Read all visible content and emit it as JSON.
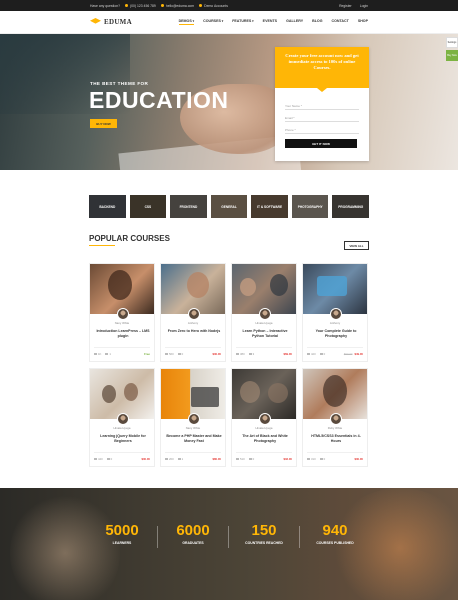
{
  "topbar": {
    "question": "Have any question?",
    "phone": "(00) 123 456 789",
    "email": "hello@eduma.com",
    "demo": "Demo Accounts",
    "register": "Register",
    "login": "Login"
  },
  "header": {
    "logo": "EDUMA",
    "nav": [
      "Demos",
      "Courses",
      "Features",
      "Events",
      "Gallery",
      "Blog",
      "Contact",
      "Shop"
    ]
  },
  "widgets": {
    "settings": "Settings",
    "buy_now": "Buy Now"
  },
  "hero": {
    "subtitle": "THE BEST THEME FOR",
    "title": "EDUCATION",
    "button": "BUY NOW"
  },
  "signup": {
    "heading": "Create your free account now and get immediate access to 100s of online Courses.",
    "name_placeholder": "Your Name *",
    "email_placeholder": "Email *",
    "phone_placeholder": "Phone *",
    "button": "GET IT NOW"
  },
  "categories": [
    "BACKEND",
    "CSS",
    "FRONTEND",
    "GENERAL",
    "IT & SOFTWARE",
    "PHOTOGRAPHY",
    "PROGRAMMING"
  ],
  "popular": {
    "title": "POPULAR COURSES",
    "view_all": "VIEW ALL"
  },
  "courses": [
    {
      "teacher": "Nany White",
      "title": "Introduction LearnPress – LMS plugin",
      "views": "1K",
      "comments": "1",
      "price": "Free",
      "old_price": ""
    },
    {
      "teacher": "Anthony",
      "title": "From Zero to Hero with Nodejs",
      "views": "560",
      "comments": "0",
      "price": "$30.00",
      "old_price": ""
    },
    {
      "teacher": "Hinata Hyuga",
      "title": "Learn Python – Interactive Python Tutorial",
      "views": "380",
      "comments": "3",
      "price": "$69.00",
      "old_price": ""
    },
    {
      "teacher": "Anthony",
      "title": "Your Complete Guide to Photography",
      "views": "420",
      "comments": "0",
      "price": "$49.00",
      "old_price": "$60.00"
    },
    {
      "teacher": "Hinata Hyuga",
      "title": "Learning jQuery Mobile for Beginners",
      "views": "440",
      "comments": "0",
      "price": "$30.00",
      "old_price": ""
    },
    {
      "teacher": "Nany White",
      "title": "Become a PHP Master and Make Money Fast",
      "views": "200",
      "comments": "1",
      "price": "$80.00",
      "old_price": ""
    },
    {
      "teacher": "Hinata Hyuga",
      "title": "The Art of Black and White Photography",
      "views": "510",
      "comments": "0",
      "price": "$32.00",
      "old_price": ""
    },
    {
      "teacher": "Ruby White",
      "title": "HTML5/CSS3 Essentials in 4-Hours",
      "views": "310",
      "comments": "0",
      "price": "$30.00",
      "old_price": ""
    }
  ],
  "stats": [
    {
      "number": "5000",
      "label": "LEARNERS"
    },
    {
      "number": "6000",
      "label": "GRADUATES"
    },
    {
      "number": "150",
      "label": "COUNTRIES REACHED"
    },
    {
      "number": "940",
      "label": "COURSES PUBLISHED"
    }
  ],
  "colors": {
    "accent": "#ffb606",
    "dark": "#1e1e1e",
    "free": "#7cb342",
    "price": "#e53935"
  }
}
